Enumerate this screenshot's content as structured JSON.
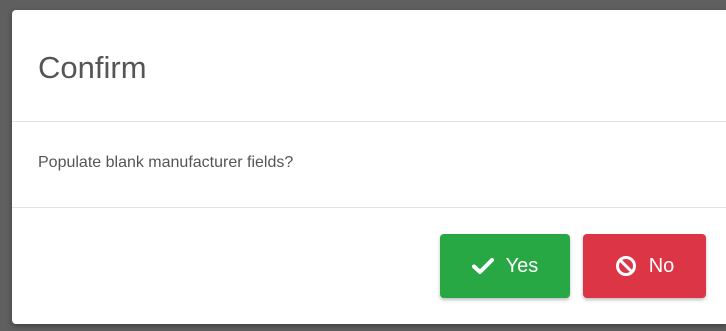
{
  "dialog": {
    "title": "Confirm",
    "message": "Populate blank manufacturer fields?",
    "buttons": {
      "yes": {
        "label": "Yes",
        "icon": "check-icon",
        "color": "#28a745"
      },
      "no": {
        "label": "No",
        "icon": "ban-icon",
        "color": "#dc3545"
      }
    }
  }
}
